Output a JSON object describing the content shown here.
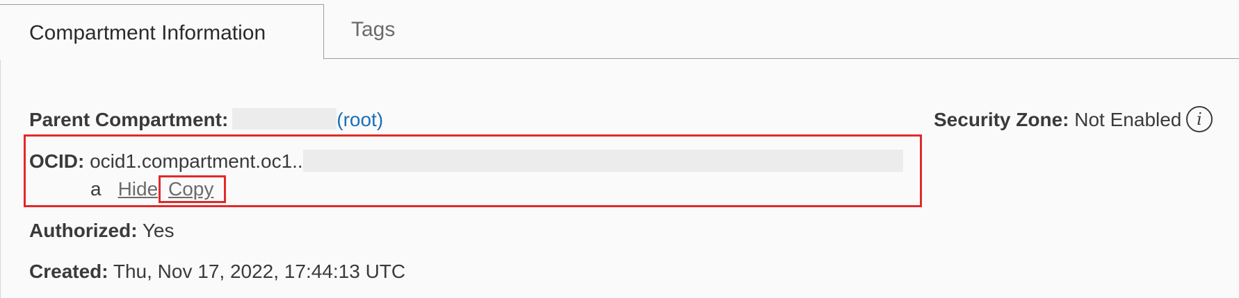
{
  "tabs": [
    {
      "label": "Compartment Information",
      "active": true
    },
    {
      "label": "Tags",
      "active": false
    }
  ],
  "details": {
    "parent_compartment": {
      "label": "Parent Compartment:",
      "link": "(root)"
    },
    "ocid": {
      "label": "OCID:",
      "value_prefix": "ocid1.compartment.oc1..",
      "value_suffix": "a",
      "hide_label": "Hide",
      "copy_label": "Copy"
    },
    "authorized": {
      "label": "Authorized:",
      "value": "Yes"
    },
    "created": {
      "label": "Created:",
      "value": "Thu, Nov 17, 2022, 17:44:13 UTC"
    },
    "security_zone": {
      "label": "Security Zone:",
      "value": "Not Enabled",
      "icon": "info-icon",
      "icon_glyph": "i"
    }
  },
  "colors": {
    "highlight": "#e0292a",
    "link": "#1a6fb8",
    "background": "#fafafa"
  }
}
